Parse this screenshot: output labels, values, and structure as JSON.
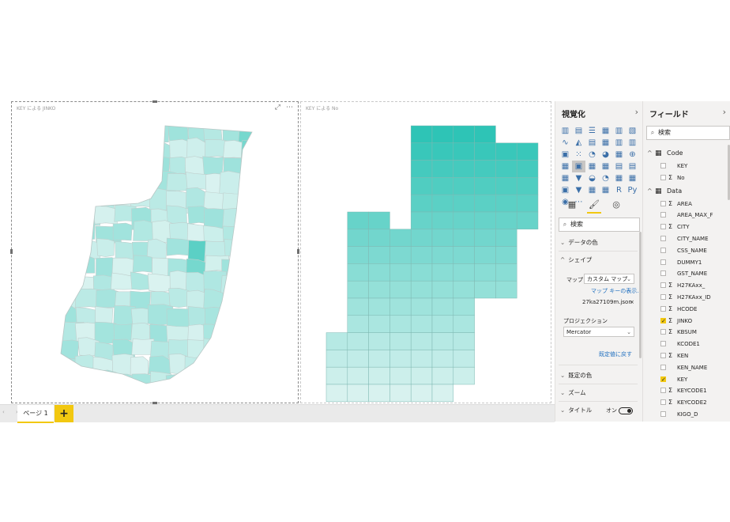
{
  "report": {
    "visual1_title": "KEY による JINKO",
    "visual2_title": "KEY による No",
    "focus_icon": "⤢",
    "more_icon": "⋯",
    "nav_arrows": "‹ ›",
    "page_tab": "ページ 1",
    "add_page": "+"
  },
  "viz_pane": {
    "title": "視覚化",
    "chevron": "›",
    "icons": [
      "▥",
      "▤",
      "☰",
      "▦",
      "▥",
      "▧",
      "∿",
      "◭",
      "▤",
      "▦",
      "▥",
      "▥",
      "▣",
      "⁙",
      "◔",
      "◕",
      "▦",
      "⊕",
      "▦",
      "▣",
      "▦",
      "▦",
      "▤",
      "▤",
      "▦",
      "▼",
      "◒",
      "◔",
      "▦",
      "▦",
      "▣",
      "▼",
      "▦",
      "▦",
      "R",
      "Py",
      "◉",
      "⋯"
    ],
    "tab_icons": [
      "▦",
      "🖌",
      "◎"
    ],
    "search_placeholder": "検索",
    "sections": {
      "data_colors": "データの色",
      "shape": "シェイプ",
      "map_label": "マップ",
      "map_value": "カスタム マップ",
      "map_keys_link": "マップ キーの表示...",
      "file_name": "27ka27109m.json",
      "file_close": "×",
      "projection_label": "プロジェクション",
      "projection_value": "Mercator",
      "reset_link": "既定値に戻す",
      "default_color": "既定の色",
      "zoom": "ズーム",
      "title": "タイトル",
      "toggle_label": "オン"
    }
  },
  "fields_pane": {
    "title": "フィールド",
    "chevron": "›",
    "search_placeholder": "検索",
    "tables": [
      {
        "name": "Code",
        "fields": [
          {
            "name": "KEY",
            "sigma": false,
            "checked": false
          },
          {
            "name": "No",
            "sigma": true,
            "checked": false
          }
        ]
      },
      {
        "name": "Data",
        "fields": [
          {
            "name": "AREA",
            "sigma": true,
            "checked": false
          },
          {
            "name": "AREA_MAX_F",
            "sigma": false,
            "checked": false
          },
          {
            "name": "CITY",
            "sigma": true,
            "checked": false
          },
          {
            "name": "CITY_NAME",
            "sigma": false,
            "checked": false
          },
          {
            "name": "CSS_NAME",
            "sigma": false,
            "checked": false
          },
          {
            "name": "DUMMY1",
            "sigma": false,
            "checked": false
          },
          {
            "name": "GST_NAME",
            "sigma": false,
            "checked": false
          },
          {
            "name": "H27KAxx_",
            "sigma": true,
            "checked": false
          },
          {
            "name": "H27KAxx_ID",
            "sigma": true,
            "checked": false
          },
          {
            "name": "HCODE",
            "sigma": true,
            "checked": false
          },
          {
            "name": "JINKO",
            "sigma": true,
            "checked": true
          },
          {
            "name": "KBSUM",
            "sigma": true,
            "checked": false
          },
          {
            "name": "KCODE1",
            "sigma": false,
            "checked": false
          },
          {
            "name": "KEN",
            "sigma": true,
            "checked": false
          },
          {
            "name": "KEN_NAME",
            "sigma": false,
            "checked": false
          },
          {
            "name": "KEY",
            "sigma": false,
            "checked": true
          },
          {
            "name": "KEYCODE1",
            "sigma": true,
            "checked": false
          },
          {
            "name": "KEYCODE2",
            "sigma": true,
            "checked": false
          },
          {
            "name": "KIGO_D",
            "sigma": false,
            "checked": false
          }
        ]
      }
    ]
  },
  "colors": {
    "accent": "#f2c811",
    "map_dark": "#2ec4b6",
    "map_light": "#e3f5f3",
    "link": "#1f6fbf"
  },
  "icons": {
    "search": "⌕",
    "sigma": "Σ",
    "table": "▦",
    "chevron_down": "⌄"
  }
}
